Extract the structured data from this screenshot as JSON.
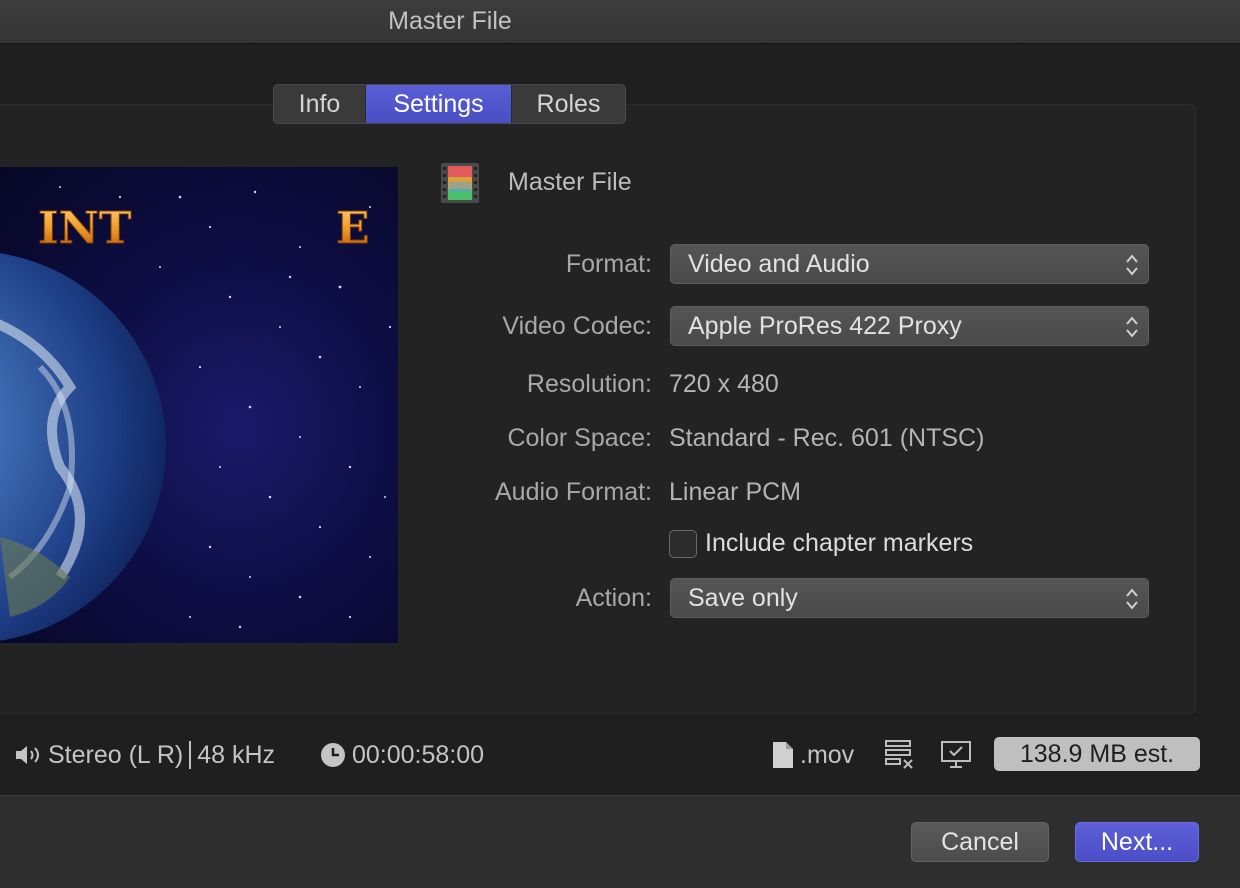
{
  "window": {
    "title": "Master File"
  },
  "tabs": [
    {
      "label": "Info",
      "selected": false
    },
    {
      "label": "Settings",
      "selected": true
    },
    {
      "label": "Roles",
      "selected": false
    }
  ],
  "preview": {
    "overlay_text_left": "INT",
    "overlay_text_right": "E"
  },
  "preset": {
    "name": "Master File",
    "icon": "film-strip-icon"
  },
  "settings": {
    "format": {
      "label": "Format:",
      "value": "Video and Audio"
    },
    "video_codec": {
      "label": "Video Codec:",
      "value": "Apple ProRes 422 Proxy"
    },
    "resolution": {
      "label": "Resolution:",
      "value": "720 x 480"
    },
    "color_space": {
      "label": "Color Space:",
      "value": "Standard - Rec. 601 (NTSC)"
    },
    "audio_format": {
      "label": "Audio Format:",
      "value": "Linear PCM"
    },
    "chapter_markers": {
      "label": "Include chapter markers",
      "checked": false
    },
    "action": {
      "label": "Action:",
      "value": "Save only"
    }
  },
  "info_bar": {
    "audio_channels": "Stereo (L R)",
    "sample_rate": "48 kHz",
    "duration": "00:00:58:00",
    "extension": ".mov",
    "estimated_size": "138.9 MB est."
  },
  "footer": {
    "cancel_label": "Cancel",
    "next_label": "Next..."
  },
  "colors": {
    "accent": "#5558d2",
    "background": "#1f1f1f",
    "footer": "#2e2e2e"
  }
}
